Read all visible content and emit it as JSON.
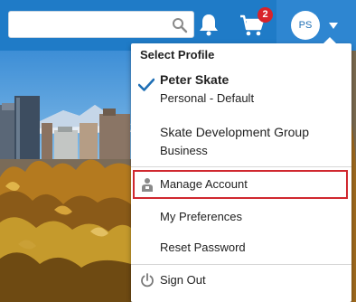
{
  "header": {
    "search": {
      "value": "",
      "placeholder": ""
    },
    "cart_count": "2",
    "avatar_initials": "PS"
  },
  "dropdown": {
    "heading": "Select Profile",
    "profiles": [
      {
        "name": "Peter Skate",
        "subtitle": "Personal - Default",
        "selected": true
      },
      {
        "name": "Skate Development Group",
        "subtitle": "Business",
        "selected": false
      }
    ],
    "menu": [
      {
        "label": "Manage Account",
        "icon": "person-icon",
        "highlighted": true
      },
      {
        "label": "My Preferences"
      },
      {
        "label": "Reset Password"
      },
      {
        "label": "Sign Out",
        "icon": "power-icon"
      }
    ]
  },
  "colors": {
    "header_blue": "#1f7bc7",
    "profile_area_blue": "#2e86d1",
    "badge_red": "#d8232a",
    "check_blue": "#1f6fb5",
    "highlight_outline": "#d0282f"
  }
}
